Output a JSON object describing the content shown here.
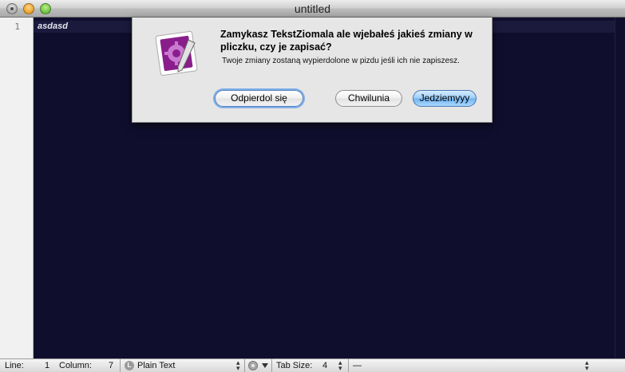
{
  "window": {
    "title": "untitled"
  },
  "editor": {
    "line_numbers": [
      "1"
    ],
    "lines": [
      "asdasd"
    ]
  },
  "dialog": {
    "title": "Zamykasz TekstZiomala ale wjebałeś jakieś zmiany w pliczku, czy je zapisać?",
    "message": "Twoje zmiany zostaną wypierdolone w pizdu jeśli ich nie zapiszesz.",
    "buttons": {
      "dont_save": "Odpierdol się",
      "cancel": "Chwilunia",
      "save": "Jedziemyyy"
    },
    "icon": "textmate-app-icon"
  },
  "statusbar": {
    "line_label": "Line:",
    "line_value": "1",
    "column_label": "Column:",
    "column_value": "7",
    "syntax_icon_letter": "L",
    "syntax": "Plain Text",
    "tab_label": "Tab Size:",
    "tab_value": "4",
    "symbol": "—"
  },
  "colors": {
    "editor_bg": "#0f0e2d",
    "icon_purple": "#8a1d8c",
    "default_button": "#7eaee8"
  }
}
